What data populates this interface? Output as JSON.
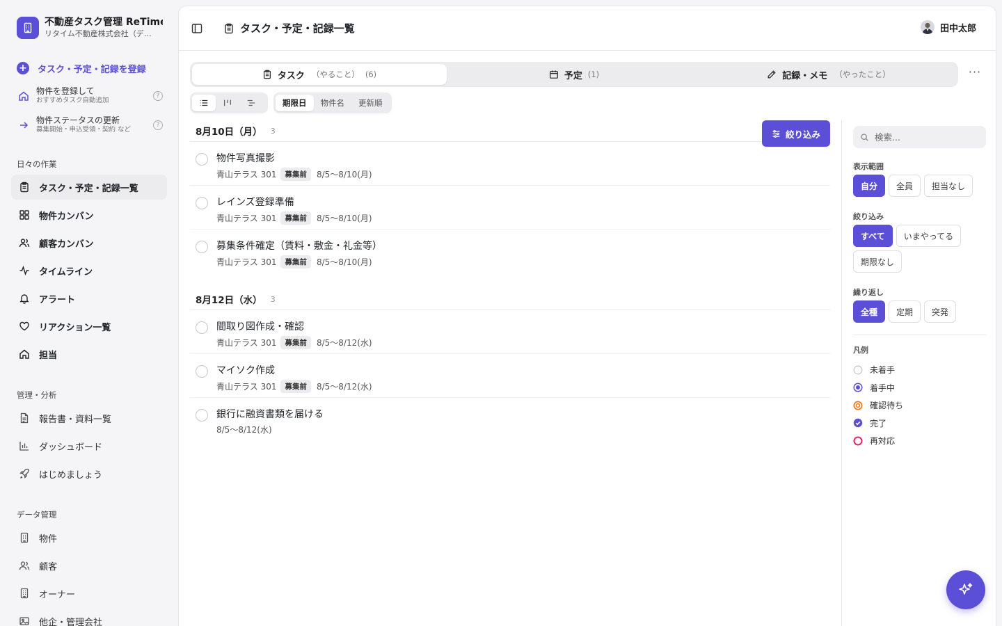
{
  "brand": {
    "title": "不動産タスク管理 ReTime",
    "subtitle": "リタイム不動産株式会社（デ…",
    "accent": "#5b4fd8"
  },
  "sidebar": {
    "register_label": "タスク・予定・記録を登録",
    "quick_actions": [
      {
        "title": "物件を登録して",
        "sub": "おすすめタスク自動追加",
        "icon": "home-icon"
      },
      {
        "title": "物件ステータスの更新",
        "sub": "募集開始・申込受領・契約 など",
        "icon": "arrow-right-icon"
      }
    ],
    "daily_label": "日々の作業",
    "daily_items": [
      {
        "label": "タスク・予定・記録一覧",
        "icon": "clipboard-icon"
      },
      {
        "label": "物件カンバン",
        "icon": "grid-icon"
      },
      {
        "label": "顧客カンバン",
        "icon": "users-icon"
      },
      {
        "label": "タイムライン",
        "icon": "activity-icon"
      },
      {
        "label": "アラート",
        "icon": "bell-icon"
      },
      {
        "label": "リアクション一覧",
        "icon": "heart-icon"
      },
      {
        "label": "担当",
        "icon": "home-icon"
      }
    ],
    "mgmt_label": "管理・分析",
    "mgmt_items": [
      {
        "label": "報告書・資料一覧",
        "icon": "document-icon"
      },
      {
        "label": "ダッシュボード",
        "icon": "bar-chart-icon"
      },
      {
        "label": "はじめましょう",
        "icon": "rocket-icon"
      }
    ],
    "data_label": "データ管理",
    "data_items": [
      {
        "label": "物件",
        "icon": "building-icon"
      },
      {
        "label": "顧客",
        "icon": "users-icon"
      },
      {
        "label": "オーナー",
        "icon": "building-icon"
      },
      {
        "label": "他企・管理会社",
        "icon": "image-icon"
      }
    ]
  },
  "header": {
    "title": "タスク・予定・記録一覧",
    "user_name": "田中太郎"
  },
  "tabs": [
    {
      "label": "タスク",
      "sub": "（やること）",
      "count": "(6)",
      "active": true
    },
    {
      "label": "予定",
      "sub": "",
      "count": "(1)",
      "active": false
    },
    {
      "label": "記録・メモ",
      "sub": "（やったこと）",
      "count": "",
      "active": false
    }
  ],
  "sort": {
    "options": [
      "期限日",
      "物件名",
      "更新順"
    ],
    "selected": "期限日"
  },
  "filter_button": "絞り込み",
  "groups": [
    {
      "date": "8月10日（月）",
      "count": "3",
      "tasks": [
        {
          "title": "物件写真撮影",
          "property": "青山テラス 301",
          "badge": "募集前",
          "period": "8/5〜8/10(月)"
        },
        {
          "title": "レインズ登録準備",
          "property": "青山テラス 301",
          "badge": "募集前",
          "period": "8/5〜8/10(月)"
        },
        {
          "title": "募集条件確定（賃料・敷金・礼金等）",
          "property": "青山テラス 301",
          "badge": "募集前",
          "period": "8/5〜8/10(月)"
        }
      ]
    },
    {
      "date": "8月12日（水）",
      "count": "3",
      "tasks": [
        {
          "title": "間取り図作成・確認",
          "property": "青山テラス 301",
          "badge": "募集前",
          "period": "8/5〜8/12(水)"
        },
        {
          "title": "マイソク作成",
          "property": "青山テラス 301",
          "badge": "募集前",
          "period": "8/5〜8/12(水)"
        },
        {
          "title": "銀行に融資書類を届ける",
          "property": "",
          "badge": "",
          "period": "8/5〜8/12(水)"
        }
      ]
    }
  ],
  "filter_panel": {
    "search_placeholder": "検索...",
    "scope_label": "表示範囲",
    "scope_options": [
      "自分",
      "全員",
      "担当なし"
    ],
    "scope_selected": "自分",
    "narrow_label": "絞り込み",
    "narrow_options": [
      "すべて",
      "いまやってる",
      "期限なし"
    ],
    "narrow_selected": "すべて",
    "repeat_label": "繰り返し",
    "repeat_options": [
      "全種",
      "定期",
      "突発"
    ],
    "repeat_selected": "全種",
    "legend_label": "凡例",
    "legend": [
      {
        "label": "未着手",
        "color": "#c8c8cc",
        "style": "empty"
      },
      {
        "label": "着手中",
        "color": "#5b4fd8",
        "style": "dot"
      },
      {
        "label": "確認待ち",
        "color": "#f07c1c",
        "style": "ring"
      },
      {
        "label": "完了",
        "color": "#5b4fd8",
        "style": "check"
      },
      {
        "label": "再対応",
        "color": "#e5245b",
        "style": "thick"
      }
    ]
  }
}
